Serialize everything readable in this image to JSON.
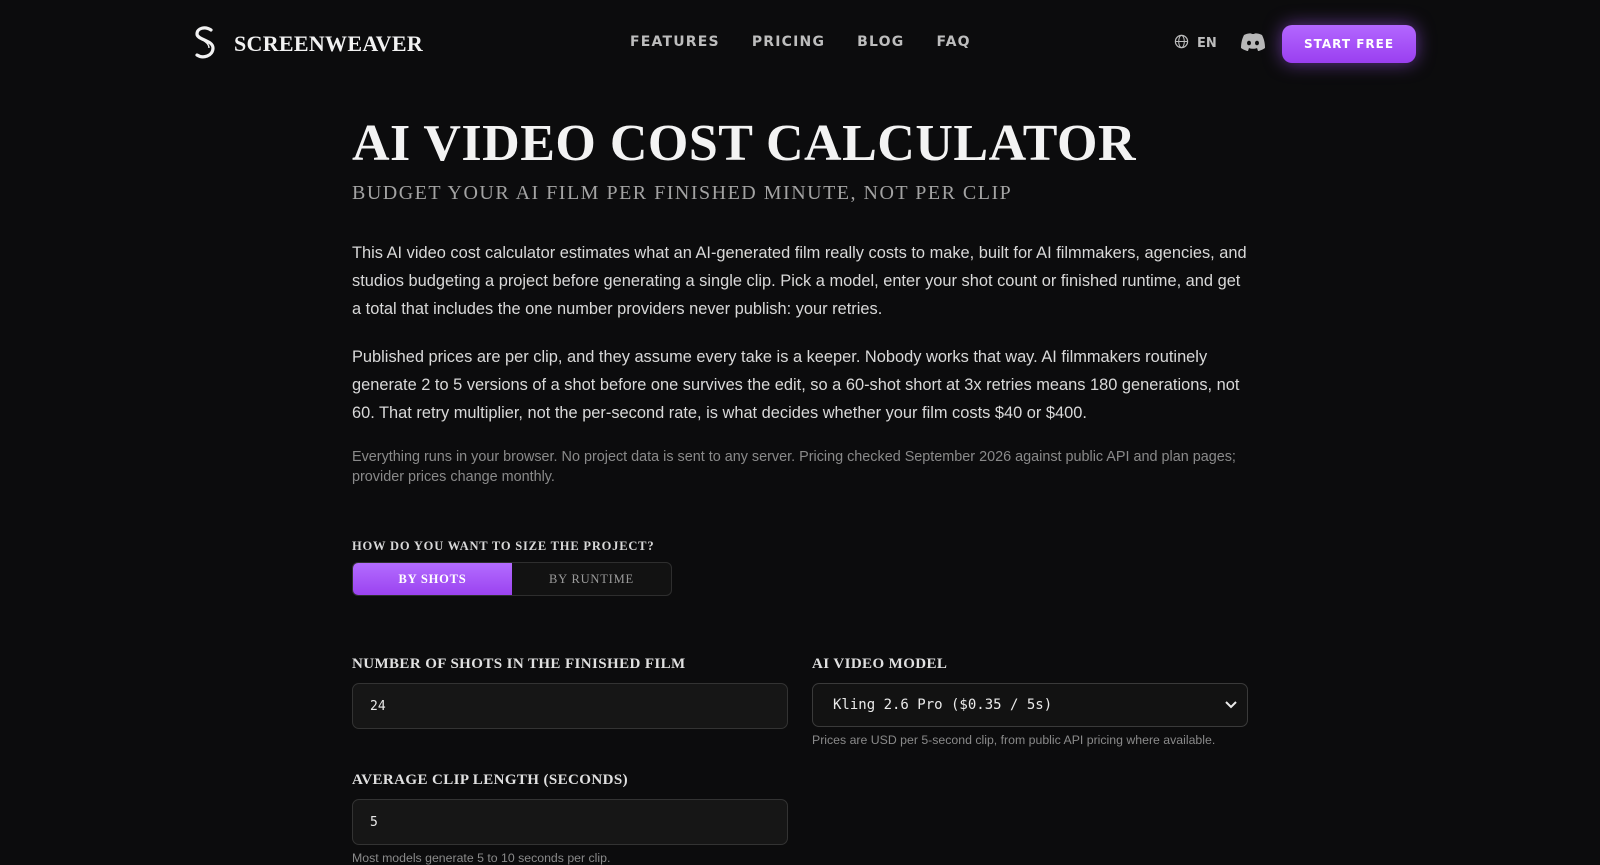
{
  "header": {
    "logo_text": "SCREENWEAVER",
    "nav": [
      "FEATURES",
      "PRICING",
      "BLOG",
      "FAQ"
    ],
    "lang": "EN",
    "cta": "START FREE"
  },
  "main": {
    "title": "AI VIDEO COST CALCULATOR",
    "subtitle": "BUDGET YOUR AI FILM PER FINISHED MINUTE, NOT PER CLIP",
    "para1": "This AI video cost calculator estimates what an AI-generated film really costs to make, built for AI filmmakers, agencies, and studios budgeting a project before generating a single clip. Pick a model, enter your shot count or finished runtime, and get a total that includes the one number providers never publish: your retries.",
    "para2": "Published prices are per clip, and they assume every take is a keeper. Nobody works that way. AI filmmakers routinely generate 2 to 5 versions of a shot before one survives the edit, so a 60-shot short at 3x retries means 180 generations, not 60. That retry multiplier, not the per-second rate, is what decides whether your film costs $40 or $400.",
    "note": "Everything runs in your browser. No project data is sent to any server. Pricing checked September 2026 against public API and plan pages; provider prices change monthly."
  },
  "calculator": {
    "size_question": "HOW DO YOU WANT TO SIZE THE PROJECT?",
    "mode_shots": "BY SHOTS",
    "mode_runtime": "BY RUNTIME",
    "shots_label": "NUMBER OF SHOTS IN THE FINISHED FILM",
    "shots_value": "24",
    "model_label": "AI VIDEO MODEL",
    "model_value": "Kling 2.6 Pro ($0.35 / 5s)",
    "model_hint": "Prices are USD per 5-second clip, from public API pricing where available.",
    "clip_label": "AVERAGE CLIP LENGTH (SECONDS)",
    "clip_value": "5",
    "clip_hint": "Most models generate 5 to 10 seconds per clip."
  },
  "colors": {
    "background": "#0c0c0d",
    "accent": "#a855f7"
  }
}
